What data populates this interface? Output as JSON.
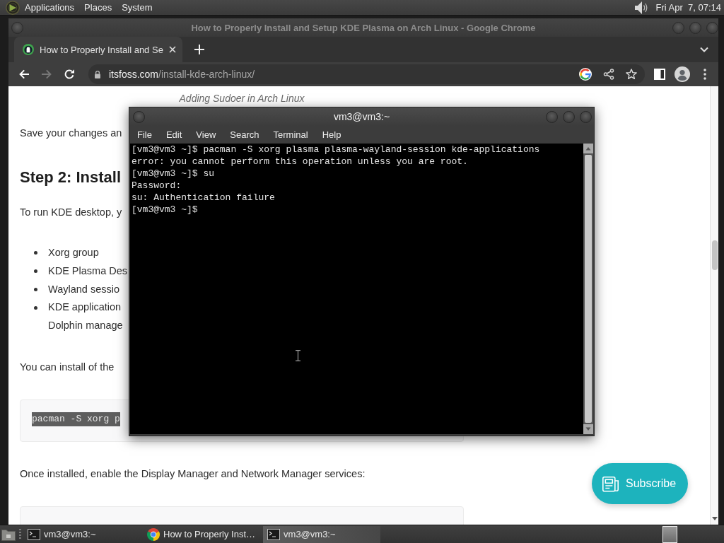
{
  "top_panel": {
    "menus": [
      "Applications",
      "Places",
      "System"
    ],
    "clock": "Fri Apr  7, 07:14"
  },
  "browser": {
    "window_title": "How to Properly Install and Setup KDE Plasma on Arch Linux - Google Chrome",
    "tabs": [
      {
        "title": "How to Properly Install and Se",
        "selected": true
      }
    ],
    "nav_buttons": [
      {
        "kind": "back",
        "disabled": false
      },
      {
        "kind": "forward",
        "disabled": true
      },
      {
        "kind": "reload",
        "disabled": false
      }
    ],
    "address": {
      "domain": "itsfoss.com",
      "path": "/install-kde-arch-linux/"
    },
    "page": {
      "caption": "Adding Sudoer in Arch Linux",
      "blocks": [
        {
          "kind": "paragraph",
          "text": "Save your changes an"
        },
        {
          "kind": "heading",
          "text": "Step 2: Install"
        },
        {
          "kind": "paragraph",
          "text": "To run KDE desktop, y"
        },
        {
          "kind": "bullets",
          "items": [
            [
              "Xorg group"
            ],
            [
              "KDE Plasma Des"
            ],
            [
              "Wayland sessio"
            ],
            [
              "KDE application",
              "Dolphin manage"
            ]
          ]
        },
        {
          "kind": "paragraph",
          "text": "You can install of the"
        },
        {
          "kind": "code",
          "text": "pacman -S xorg p",
          "highlighted": true
        },
        {
          "kind": "paragraph",
          "text": "Once installed, enable the Display Manager and Network Manager services:"
        },
        {
          "kind": "code"
        }
      ],
      "subscribe_button": "Subscribe"
    }
  },
  "terminal": {
    "title": "vm3@vm3:~",
    "menus": [
      "File",
      "Edit",
      "View",
      "Search",
      "Terminal",
      "Help"
    ],
    "lines": [
      "[vm3@vm3 ~]$ pacman -S xorg plasma plasma-wayland-session kde-applications",
      "error: you cannot perform this operation unless you are root.",
      "[vm3@vm3 ~]$ su",
      "Password:",
      "su: Authentication failure",
      "[vm3@vm3 ~]$"
    ]
  },
  "taskbar": {
    "tasks": [
      {
        "kind": "terminal",
        "label": "vm3@vm3:~",
        "selected": false
      },
      {
        "kind": "browser",
        "label": "How to Properly Inst…",
        "selected": false
      },
      {
        "kind": "terminal",
        "label": "vm3@vm3:~",
        "selected": true
      }
    ]
  }
}
